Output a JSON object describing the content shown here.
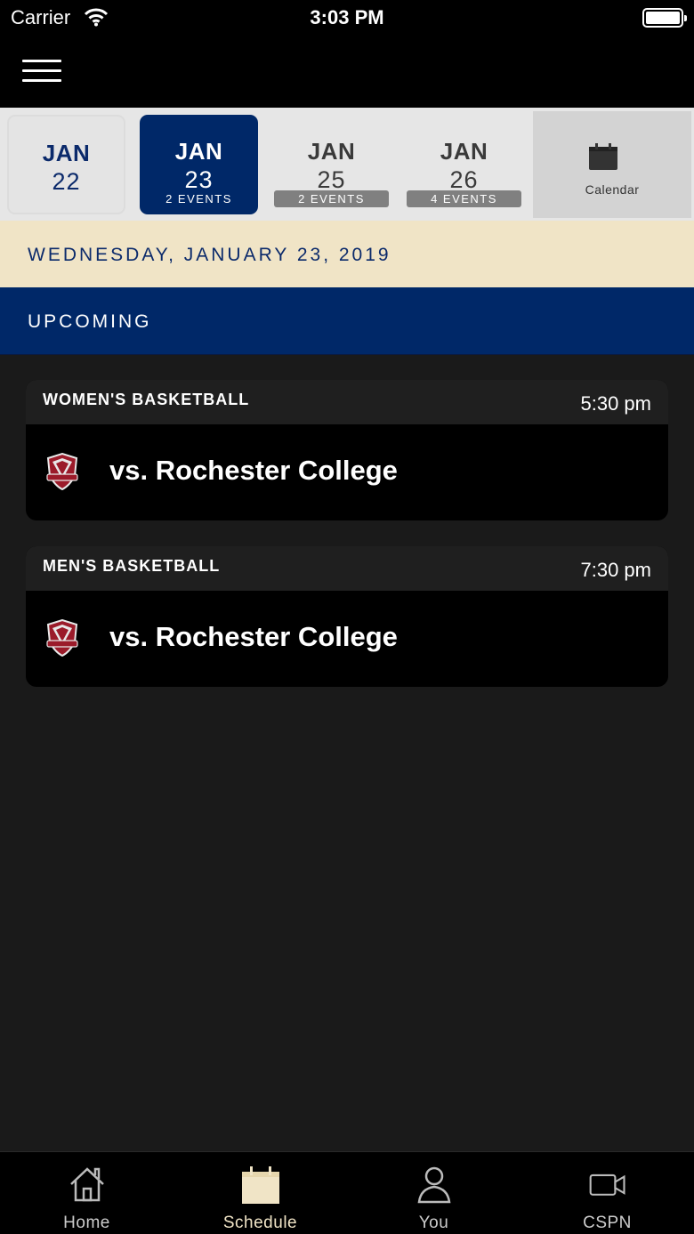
{
  "status_bar": {
    "carrier": "Carrier",
    "time": "3:03 PM"
  },
  "date_strip": {
    "days": [
      {
        "month": "JAN",
        "day": "22",
        "events": ""
      },
      {
        "month": "JAN",
        "day": "23",
        "events": "2 EVENTS",
        "selected": true
      },
      {
        "month": "JAN",
        "day": "25",
        "events": "2 EVENTS"
      },
      {
        "month": "JAN",
        "day": "26",
        "events": "4 EVENTS"
      }
    ],
    "calendar_label": "Calendar"
  },
  "selected_date": "WEDNESDAY, JANUARY 23, 2019",
  "section_title": "UPCOMING",
  "events": [
    {
      "sport": "WOMEN'S BASKETBALL",
      "time": "5:30 pm",
      "opponent": "vs. Rochester College",
      "logo_icon": "warriors-logo-icon"
    },
    {
      "sport": "MEN'S BASKETBALL",
      "time": "7:30 pm",
      "opponent": "vs. Rochester College",
      "logo_icon": "warriors-logo-icon"
    }
  ],
  "tabs": [
    {
      "label": "Home",
      "icon": "home-icon"
    },
    {
      "label": "Schedule",
      "icon": "calendar-icon",
      "active": true
    },
    {
      "label": "You",
      "icon": "person-icon"
    },
    {
      "label": "CSPN",
      "icon": "video-camera-icon"
    }
  ],
  "colors": {
    "navy": "#002868",
    "cream": "#f0e4c6",
    "background": "#1a1a1a",
    "badge_gray": "#808080"
  }
}
